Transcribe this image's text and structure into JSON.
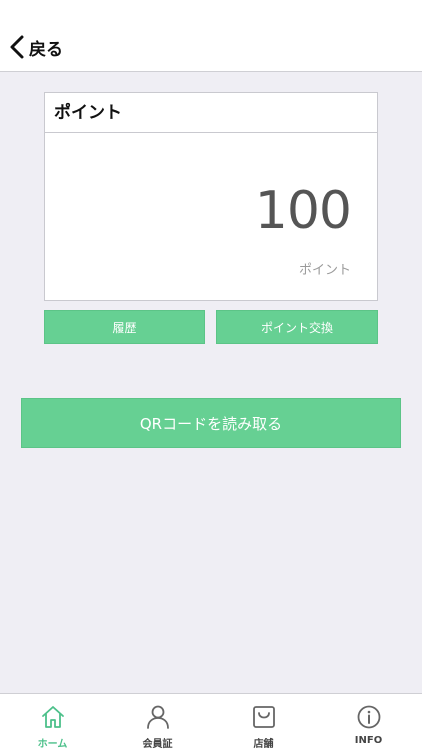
{
  "header": {
    "back_label": "戻る"
  },
  "points_card": {
    "title": "ポイント",
    "value": "100",
    "unit": "ポイント"
  },
  "buttons": {
    "history": "履歴",
    "exchange": "ポイント交換",
    "qr_scan": "QRコードを読み取る"
  },
  "tabbar": {
    "active": "home",
    "items": [
      {
        "id": "home",
        "label": "ホーム",
        "icon": "home-icon"
      },
      {
        "id": "member",
        "label": "会員証",
        "icon": "person-icon"
      },
      {
        "id": "store",
        "label": "店舗",
        "icon": "shopping-bag-icon"
      },
      {
        "id": "info",
        "label": "INFO",
        "icon": "info-icon"
      }
    ]
  },
  "colors": {
    "accent": "#66d093",
    "active_tab": "#4cc08a",
    "background": "#efeef4"
  }
}
